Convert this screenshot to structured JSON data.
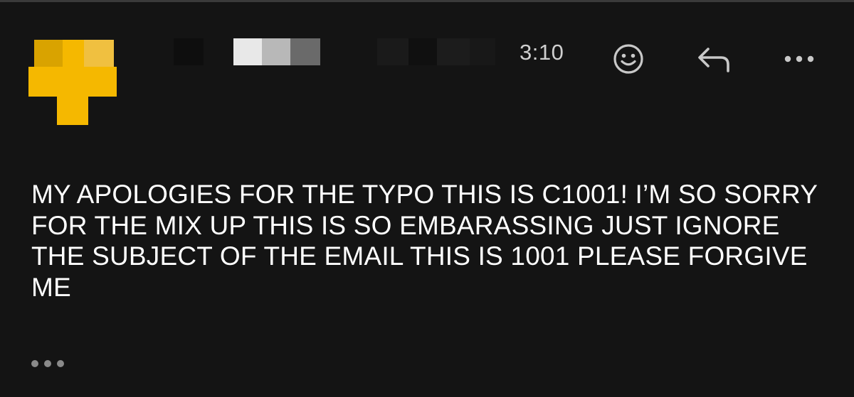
{
  "message": {
    "time": "3:10",
    "body": "MY APOLOGIES FOR THE TYPO THIS IS C1001! I’M SO SORRY FOR THE MIX UP THIS IS SO EMBARASSING JUST IGNORE THE SUBJECT OF THE EMAIL THIS IS 1001 PLEASE FORGIVE ME"
  },
  "toolbar": {
    "icons": [
      "emoji-reaction-icon",
      "reply-icon",
      "more-options-icon"
    ]
  },
  "colors": {
    "background": "#141414",
    "avatar": "#f5b800",
    "text": "#ffffff",
    "muted": "#8a8a8a"
  }
}
